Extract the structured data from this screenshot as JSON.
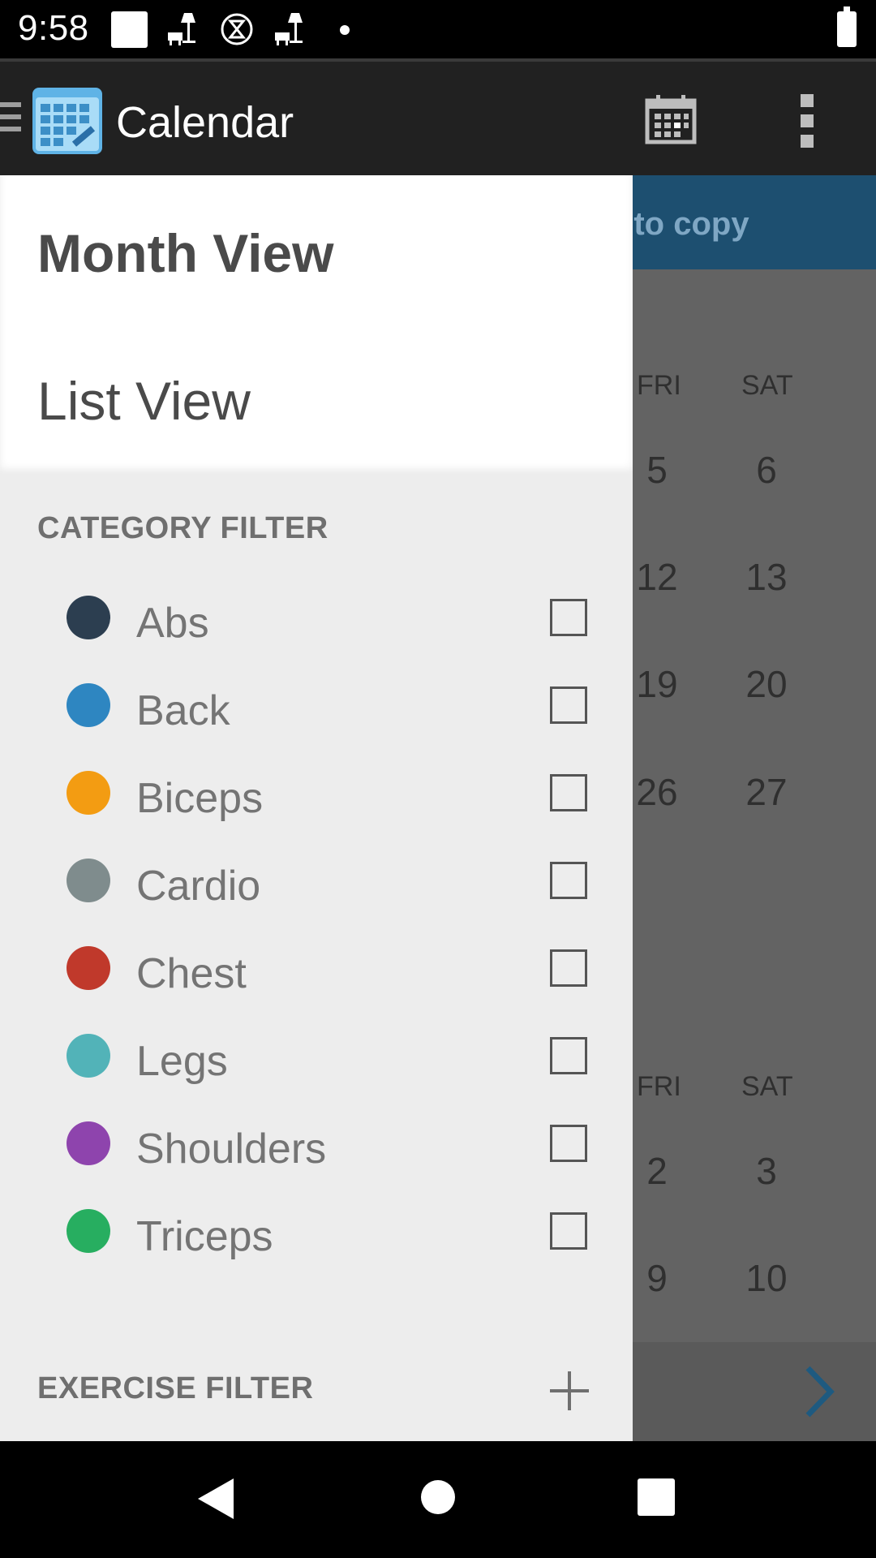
{
  "status_bar": {
    "time": "9:58"
  },
  "toolbar": {
    "title": "Calendar"
  },
  "background": {
    "banner_text": "e to copy",
    "month1": {
      "day_labels": [
        "FRI",
        "SAT"
      ],
      "weeks": [
        [
          "5",
          "6"
        ],
        [
          "12",
          "13"
        ],
        [
          "19",
          "20"
        ],
        [
          "26",
          "27"
        ]
      ]
    },
    "month2": {
      "day_labels": [
        "FRI",
        "SAT"
      ],
      "weeks": [
        [
          "2",
          "3"
        ],
        [
          "9",
          "10"
        ]
      ]
    }
  },
  "drawer": {
    "views": {
      "month": "Month View",
      "list": "List View"
    },
    "category_filter_title": "CATEGORY FILTER",
    "categories": [
      {
        "label": "Abs",
        "color": "#2c3e50"
      },
      {
        "label": "Back",
        "color": "#2e86c1"
      },
      {
        "label": "Biceps",
        "color": "#f39c12"
      },
      {
        "label": "Cardio",
        "color": "#7f8c8d"
      },
      {
        "label": "Chest",
        "color": "#c0392b"
      },
      {
        "label": "Legs",
        "color": "#52b3b8"
      },
      {
        "label": "Shoulders",
        "color": "#8e44ad"
      },
      {
        "label": "Triceps",
        "color": "#27ae60"
      }
    ],
    "exercise_filter_title": "EXERCISE FILTER"
  }
}
